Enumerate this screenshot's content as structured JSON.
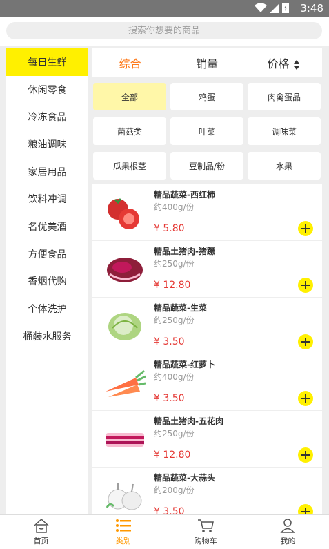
{
  "status": {
    "time": "3:48"
  },
  "search": {
    "placeholder": "搜索你想要的商品"
  },
  "sidebar": {
    "items": [
      {
        "label": "每日生鲜",
        "active": true
      },
      {
        "label": "休闲零食"
      },
      {
        "label": "冷冻食品"
      },
      {
        "label": "粮油调味"
      },
      {
        "label": "家居用品"
      },
      {
        "label": "饮料冲调"
      },
      {
        "label": "名优美酒"
      },
      {
        "label": "方便食品"
      },
      {
        "label": "香烟代购"
      },
      {
        "label": "个体洗护"
      },
      {
        "label": "桶装水服务"
      }
    ]
  },
  "sort": {
    "items": [
      {
        "label": "综合",
        "active": true
      },
      {
        "label": "销量"
      },
      {
        "label": "价格"
      }
    ]
  },
  "chips": [
    {
      "label": "全部",
      "active": true
    },
    {
      "label": "鸡蛋"
    },
    {
      "label": "肉禽蛋品"
    },
    {
      "label": "菌菇类"
    },
    {
      "label": "叶菜"
    },
    {
      "label": "调味菜"
    },
    {
      "label": "瓜果根茎"
    },
    {
      "label": "豆制品/粉"
    },
    {
      "label": "水果"
    }
  ],
  "products": [
    {
      "name": "精品蔬菜-西红柿",
      "weight": "约400g/份",
      "price": "¥ 5.80",
      "icon": "tomato-icon"
    },
    {
      "name": "精品土猪肉-猪蹶",
      "weight": "约250g/份",
      "price": "¥ 12.80",
      "icon": "pork-icon"
    },
    {
      "name": "精品蔬菜-生菜",
      "weight": "约250g/份",
      "price": "¥ 3.50",
      "icon": "lettuce-icon"
    },
    {
      "name": "精品蔬菜-红萝卜",
      "weight": "约400g/份",
      "price": "¥ 3.50",
      "icon": "carrot-icon"
    },
    {
      "name": "精品土猪肉-五花肉",
      "weight": "约250g/份",
      "price": "¥ 12.80",
      "icon": "pork-belly-icon"
    },
    {
      "name": "精品蔬菜-大蒜头",
      "weight": "约200g/份",
      "price": "¥ 3.50",
      "icon": "garlic-icon"
    }
  ],
  "tabs": [
    {
      "label": "首页",
      "icon": "home-icon"
    },
    {
      "label": "类别",
      "icon": "category-icon",
      "active": true
    },
    {
      "label": "购物车",
      "icon": "cart-icon"
    },
    {
      "label": "我的",
      "icon": "user-icon"
    }
  ],
  "colors": {
    "accent": "#fff000",
    "active_text": "#ff7a1a",
    "price": "#e53935",
    "tab_active": "#ff9800"
  }
}
